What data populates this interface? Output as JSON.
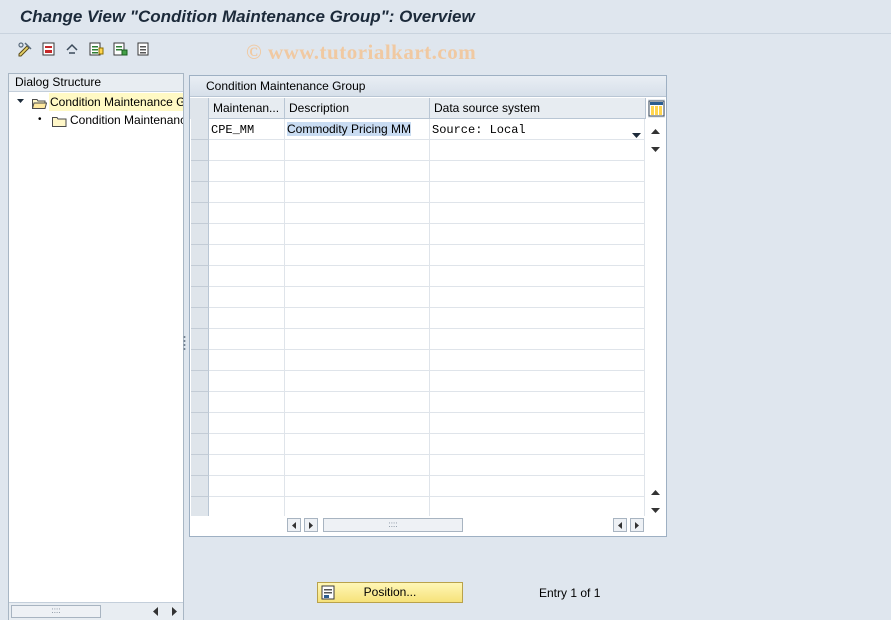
{
  "window": {
    "title": "Change View \"Condition Maintenance Group\": Overview",
    "watermark": "© www.tutorialkart.com"
  },
  "toolbar": {
    "icons": [
      "display-change-icon",
      "new-entries-icon",
      "undo-icon",
      "copy-as-icon",
      "delete-icon",
      "select-all-icon"
    ]
  },
  "dialog_structure": {
    "header": "Dialog Structure",
    "items": [
      {
        "label": "Condition Maintenance Group",
        "level": 0,
        "expanded": true,
        "selected": true
      },
      {
        "label": "Condition Maintenance Group",
        "level": 1,
        "expanded": false,
        "selected": false
      }
    ]
  },
  "table": {
    "group_title": "Condition Maintenance Group",
    "columns": [
      "Maintenan...",
      "Description",
      "Data source system"
    ],
    "rows": [
      {
        "code": "CPE_MM",
        "description": "Commodity Pricing MM",
        "source": "Source: Local"
      }
    ],
    "empty_rows": 18
  },
  "footer": {
    "position_button": "Position...",
    "entry_info": "Entry 1 of 1"
  },
  "colors": {
    "accent_yellow": "#f6e27a",
    "header_blue": "#e7ecf1",
    "selection": "#c9dcf2"
  }
}
